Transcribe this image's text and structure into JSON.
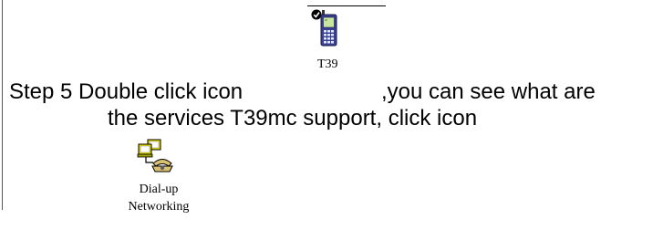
{
  "step": {
    "line1_before_icon": "Step 5 Double click icon",
    "line1_after_icon": ",you can see what are",
    "line2": "the services T39mc support, click icon"
  },
  "icons": {
    "phone": {
      "name": "mobile-phone-icon",
      "caption": "T39"
    },
    "dialup": {
      "name": "dial-up-networking-icon",
      "caption_line1": "Dial-up",
      "caption_line2": "Networking"
    }
  },
  "colors": {
    "text": "#000000",
    "phone_body": "#3a3f8f",
    "phone_screen": "#c8e6a0",
    "folder_yellow": "#e8e000",
    "phone_handset": "#d8c070"
  }
}
